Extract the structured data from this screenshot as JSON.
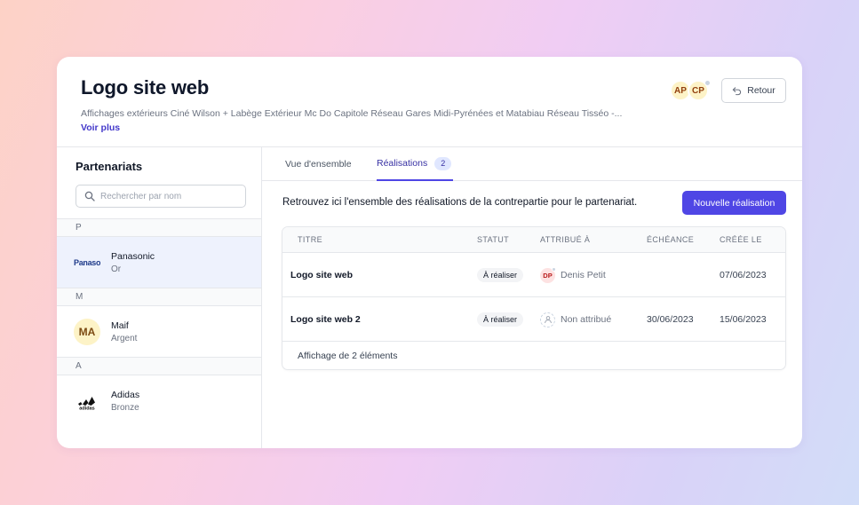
{
  "header": {
    "title": "Logo site web",
    "description": "Affichages extérieurs Ciné Wilson + Labège Extérieur Mc Do Capitole Réseau Gares Midi-Pyrénées et Matabiau Réseau Tisséo -...",
    "see_more": "Voir plus",
    "avatars": [
      "AP",
      "CP"
    ],
    "back_label": "Retour"
  },
  "sidebar": {
    "title": "Partenariats",
    "search_placeholder": "Rechercher par nom",
    "groups": [
      {
        "letter": "P",
        "partners": [
          {
            "name": "Panasonic",
            "tier": "Or",
            "logo_text": "Panasonic",
            "selected": true
          }
        ]
      },
      {
        "letter": "M",
        "partners": [
          {
            "name": "Maif",
            "tier": "Argent",
            "initials": "MA"
          }
        ]
      },
      {
        "letter": "A",
        "partners": [
          {
            "name": "Adidas",
            "tier": "Bronze",
            "logo_text": "adidas"
          }
        ]
      }
    ]
  },
  "main": {
    "tabs": [
      {
        "label": "Vue d'ensemble"
      },
      {
        "label": "Réalisations",
        "count": "2",
        "active": true
      }
    ],
    "intro": "Retrouvez ici l'ensemble des réalisations de la contrepartie pour le partenariat.",
    "new_button": "Nouvelle réalisation",
    "table": {
      "columns": [
        "TITRE",
        "STATUT",
        "ATTRIBUÉ À",
        "ÉCHÉANCE",
        "CRÉÉE LE"
      ],
      "rows": [
        {
          "title": "Logo site web",
          "status": "À réaliser",
          "assignee": "Denis Petit",
          "assignee_initials": "DP",
          "due": "",
          "created": "07/06/2023"
        },
        {
          "title": "Logo site web 2",
          "status": "À réaliser",
          "assignee": "Non attribué",
          "due": "30/06/2023",
          "created": "15/06/2023"
        }
      ],
      "footer": "Affichage de 2 éléments"
    }
  },
  "colors": {
    "accent": "#4f46e5",
    "selected_row": "#eef2fd",
    "avatar_bg": "#fdf3c7"
  }
}
